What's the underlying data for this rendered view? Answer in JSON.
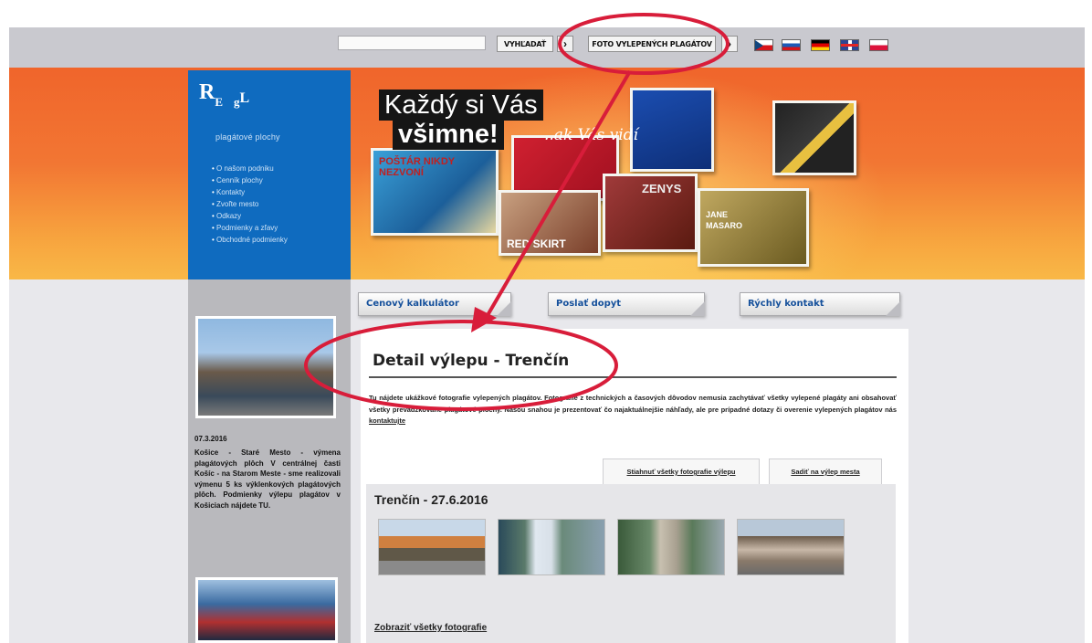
{
  "topbar": {
    "search_placeholder": "",
    "search_button": "VYHĽADAŤ",
    "search_arrow": "›",
    "posters_button": "FOTO VYLEPENÝCH PLAGÁTOV",
    "posters_arrow": "›",
    "languages": [
      "cz-flag-icon",
      "sk-flag-icon",
      "de-flag-icon",
      "en-flag-icon",
      "pl-flag-icon"
    ]
  },
  "sidebar": {
    "logo_r": "R",
    "logo_e": "E",
    "logo_g": "g",
    "logo_l": "L",
    "tagline": "plagátové plochy",
    "items": [
      {
        "label": "O našom podniku"
      },
      {
        "label": "Cenník plochy"
      },
      {
        "label": "Kontakty"
      },
      {
        "label": "Zvoľte mesto"
      },
      {
        "label": "Odkazy"
      },
      {
        "label": "Podmienky a zľavy"
      },
      {
        "label": "Obchodné podmienky"
      }
    ]
  },
  "banner": {
    "headline_line1": "Každý si Vás",
    "headline_line2": "všimne!",
    "headline_script": "..ak Vás vidí",
    "poster_texts": [
      "POŠTÁR NIKDY NEZVONÍ",
      "RED SKIRT",
      "ZENYS",
      "JANE MASARO"
    ]
  },
  "tabs": [
    {
      "label": "Cenový kalkulátor"
    },
    {
      "label": "Poslať dopyt"
    },
    {
      "label": "Rýchly kontakt"
    }
  ],
  "news": {
    "date": "07.3.2016",
    "text": "Košice - Staré Mesto - výmena plagátových plôch V centrálnej časti Košíc - na Starom Meste - sme realizovali výmenu 5 ks výklenkových plagátových plôch. Podmienky výlepu plagátov v Košiciach nájdete TU."
  },
  "detail": {
    "title": "Detail výlepu - Trenčín",
    "intro": "Tu nájdete ukážkové fotografie vylepených plagátov. Fotografie z technických a časových dôvodov nemusia zachytávať všetky vylepené plagáty ani obsahovať všetky prevádzkované plagátové plochy. Našou snahou je prezentovať čo najaktuálnejšie náhľady, ale pre prípadné dotazy či overenie vylepených plagátov nás",
    "intro_link": "kontaktujte",
    "subtab_download": "Stiahnuť všetky fotografie výlepu",
    "subtab_order": "Sadiť na výlep mesta",
    "gallery_title": "Trenčín - 27.6.2016",
    "show_all": "Zobraziť všetky fotografie"
  },
  "annotation": {
    "color": "#d81d3a"
  }
}
